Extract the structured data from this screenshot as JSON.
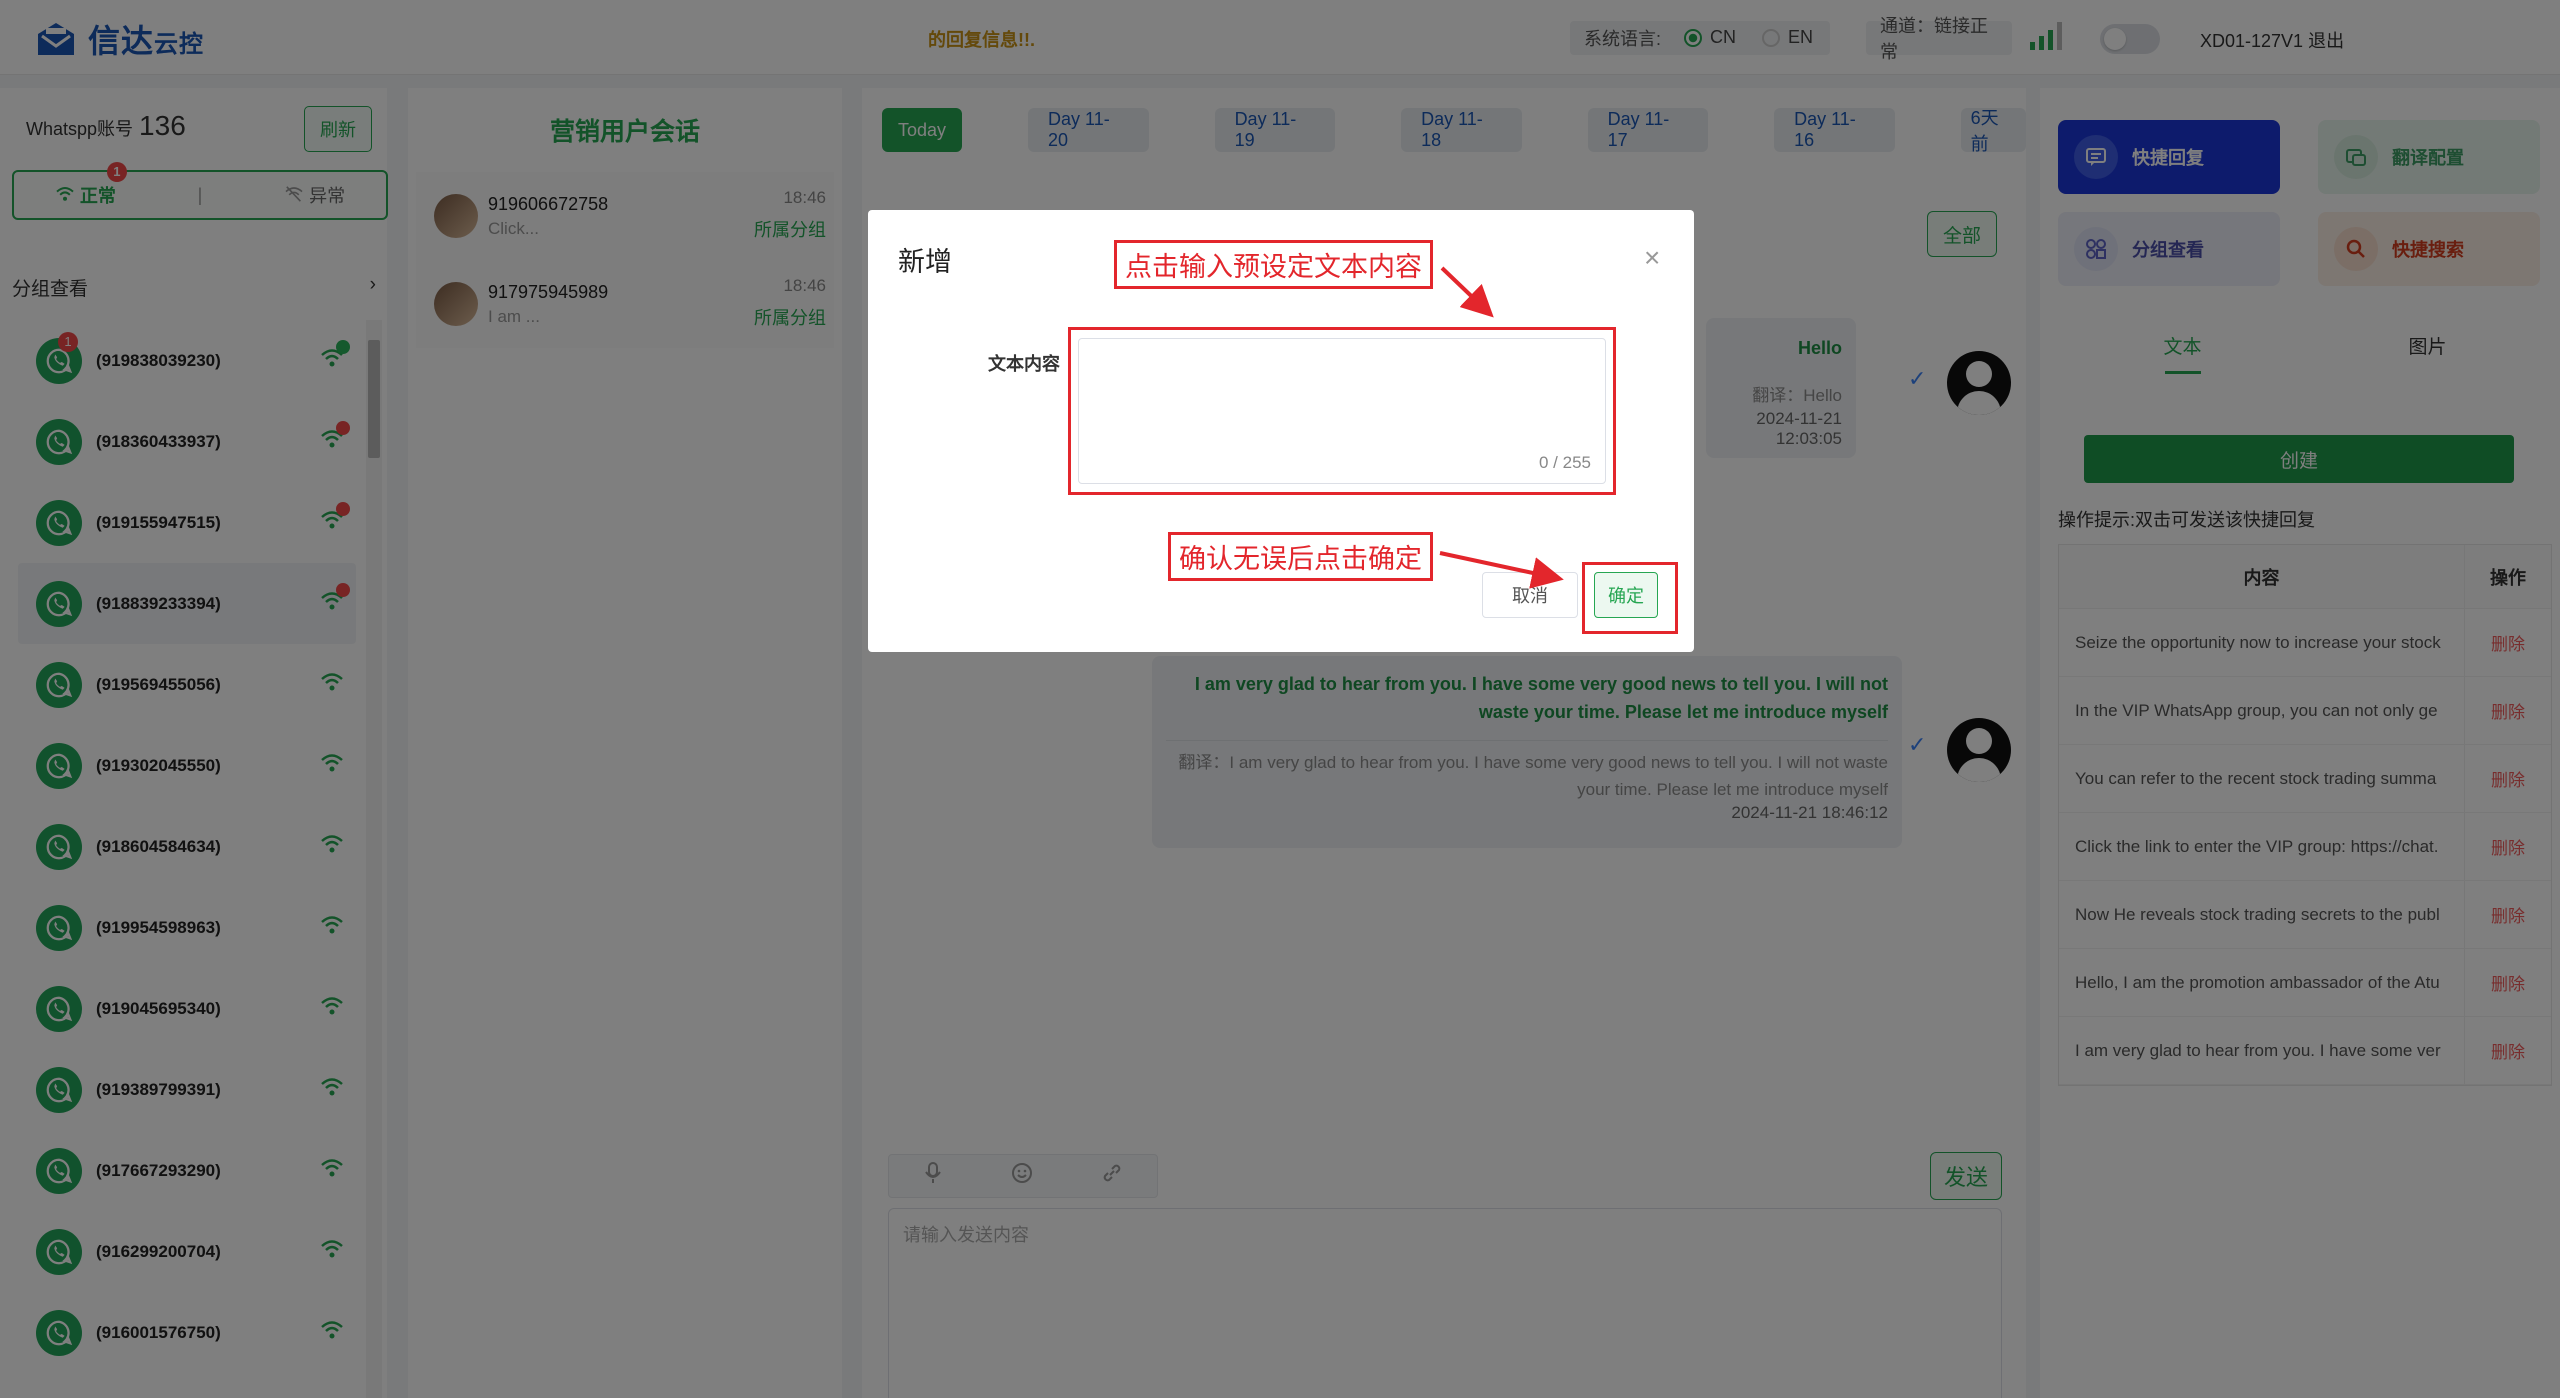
{
  "header": {
    "logo_text": "信达",
    "logo_sub": "云控",
    "marquee": "的回复信息!!.",
    "lang_label": "系统语言:",
    "lang_cn": "CN",
    "lang_en": "EN",
    "channel": "通道：链接正常",
    "user": "XD01-127V1 退出",
    "colors": {
      "brand": "#1a56b5",
      "accent": "#26a652"
    }
  },
  "left": {
    "account_label": "Whatspp账号",
    "account_count": "136",
    "refresh": "刷新",
    "status_normal": "正常",
    "status_normal_badge": "1",
    "status_abnormal": "异常",
    "group_view": "分组查看",
    "accounts": [
      {
        "number": "(919838039230)",
        "badge": "1",
        "dot": "green"
      },
      {
        "number": "(918360433937)",
        "badge": "",
        "dot": "red"
      },
      {
        "number": "(919155947515)",
        "badge": "",
        "dot": "red"
      },
      {
        "number": "(918839233394)",
        "badge": "",
        "dot": "red",
        "selected": true
      },
      {
        "number": "(919569455056)",
        "badge": "",
        "dot": ""
      },
      {
        "number": "(919302045550)",
        "badge": "",
        "dot": ""
      },
      {
        "number": "(918604584634)",
        "badge": "",
        "dot": ""
      },
      {
        "number": "(919954598963)",
        "badge": "",
        "dot": ""
      },
      {
        "number": "(919045695340)",
        "badge": "",
        "dot": ""
      },
      {
        "number": "(919389799391)",
        "badge": "",
        "dot": ""
      },
      {
        "number": "(917667293290)",
        "badge": "",
        "dot": ""
      },
      {
        "number": "(916299200704)",
        "badge": "",
        "dot": ""
      },
      {
        "number": "(916001576750)",
        "badge": "",
        "dot": ""
      }
    ]
  },
  "sessions": {
    "title": "营销用户会话",
    "items": [
      {
        "number": "919606672758",
        "snippet": "Click...",
        "time": "18:46",
        "group": "所属分组"
      },
      {
        "number": "917975945989",
        "snippet": "I am ...",
        "time": "18:46",
        "group": "所属分组"
      }
    ]
  },
  "chat": {
    "tabs": [
      "Today",
      "Day 11-20",
      "Day 11-19",
      "Day 11-18",
      "Day 11-17",
      "Day 11-16",
      "6天前"
    ],
    "all_button": "全部",
    "messages": [
      {
        "text": "Hello",
        "translation": "翻译：Hello",
        "time": "2024-11-21 12:03:05"
      },
      {
        "text": "I am very glad to hear from you. I have some very good news to tell you. I will not waste your time. Please let me introduce myself",
        "translation": "翻译：I am very glad to hear from you. I have some very good news to tell you. I will not waste your time. Please let me introduce myself",
        "time": "2024-11-21 18:46:12"
      }
    ],
    "send": "发送",
    "input_placeholder": "请输入发送内容"
  },
  "right": {
    "quick_reply": "快捷回复",
    "translate_config": "翻译配置",
    "group_view": "分组查看",
    "quick_search": "快捷搜索",
    "tab_text": "文本",
    "tab_image": "图片",
    "create": "创建",
    "hint": "操作提示:双击可发送该快捷回复",
    "table_head_content": "内容",
    "table_head_action": "操作",
    "delete": "删除",
    "rows": [
      "Seize the opportunity now to increase your stock",
      "In the VIP WhatsApp group, you can not only ge",
      "You can refer to the recent stock trading summa",
      "Click the link to enter the VIP group: https://chat.",
      "Now He reveals stock trading secrets to the publ",
      "Hello, I am the promotion ambassador of the Atu",
      "I am very glad to hear from you. I have some ver"
    ]
  },
  "modal": {
    "title": "新增",
    "field_label": "文本内容",
    "counter": "0 / 255",
    "cancel": "取消",
    "ok": "确定",
    "annotation_input": "点击输入预设定文本内容",
    "annotation_confirm": "确认无误后点击确定"
  }
}
